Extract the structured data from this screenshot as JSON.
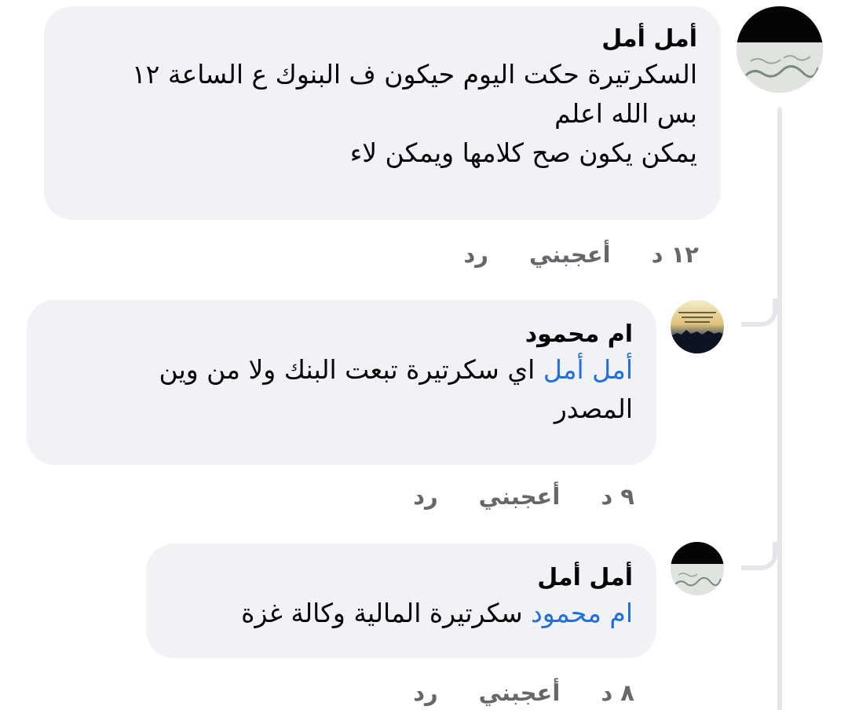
{
  "comments": [
    {
      "author": "أمل أمل",
      "lines": [
        "السكرتيرة حكت اليوم حيكون ف البنوك ع الساعة ١٢",
        "بس الله اعلم",
        "يمكن يكون صح كلامها ويمكن لاء"
      ],
      "time": "١٢ د",
      "like_label": "أعجبني",
      "reply_label": "رد"
    },
    {
      "author": "ام محمود",
      "mention": "أمل أمل",
      "text_after_mention": " اي سكرتيرة تبعت البنك ولا من وين",
      "line2": "المصدر",
      "time": "٩ د",
      "like_label": "أعجبني",
      "reply_label": "رد"
    },
    {
      "author": "أمل أمل",
      "mention": "ام محمود",
      "text_after_mention": " سكرتيرة المالية وكالة  غزة",
      "time": "٨ د",
      "like_label": "أعجبني",
      "reply_label": "رد"
    }
  ]
}
